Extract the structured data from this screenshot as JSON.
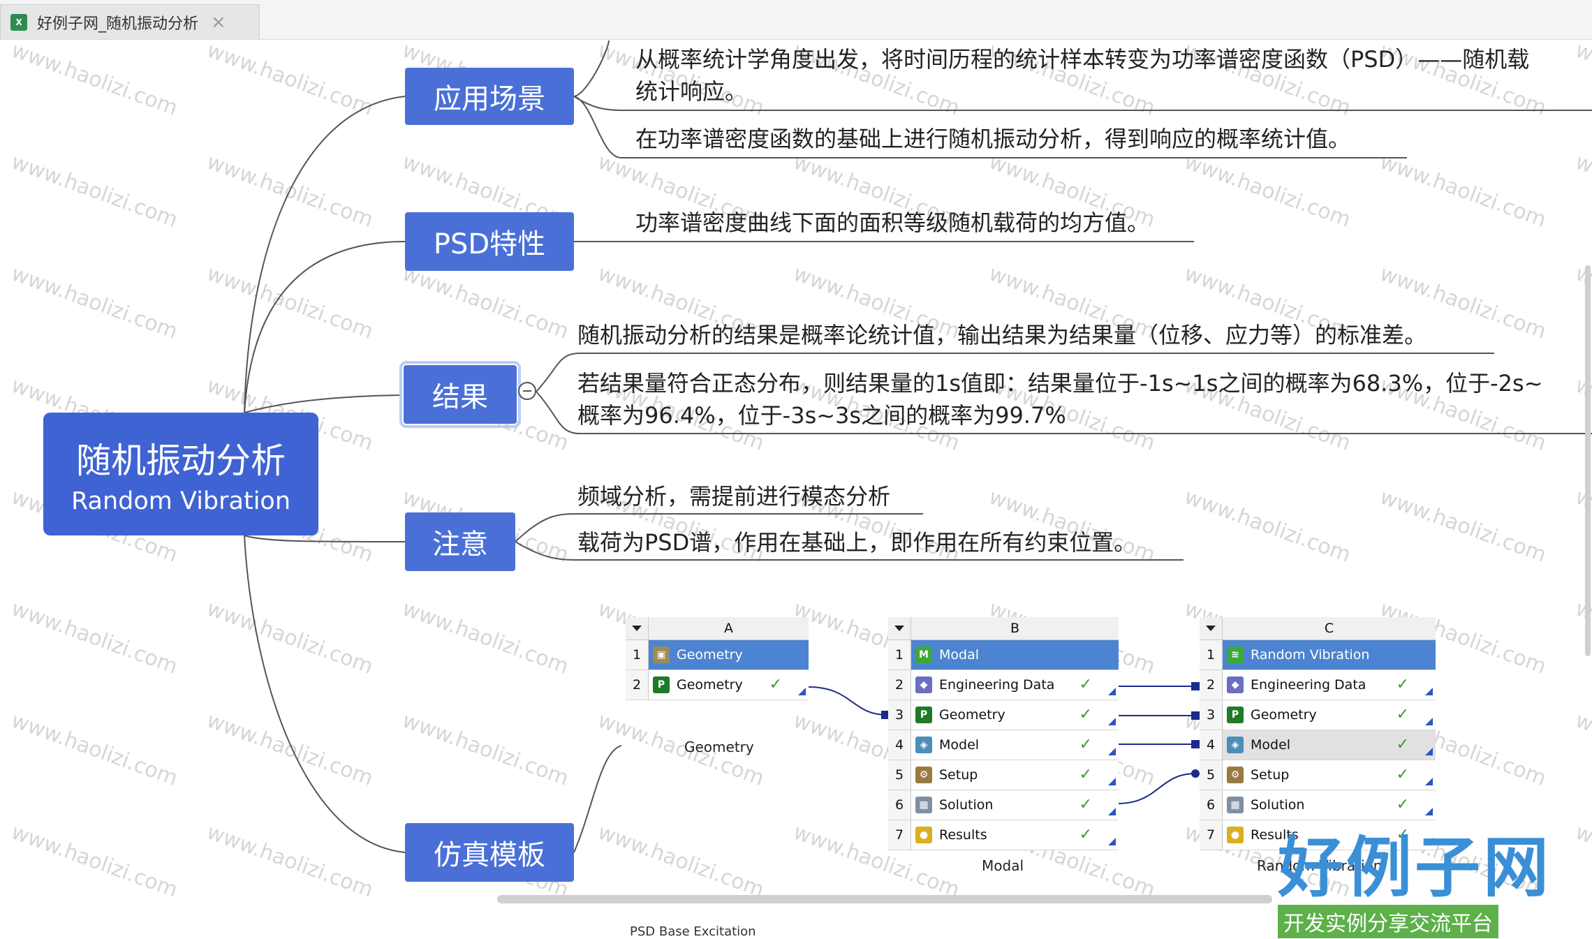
{
  "tab": {
    "icon": "xmind-file-icon",
    "title": "好例子网_随机振动分析",
    "close": "×"
  },
  "root": {
    "title_cn": "随机振动分析",
    "title_en": "Random Vibration"
  },
  "branches": [
    {
      "label": "应用场景",
      "leaves": [
        "从概率统计学角度出发，将时间历程的统计样本转变为功率谱密度函数（PSD）——随机载",
        "统计响应。",
        "在功率谱密度函数的基础上进行随机振动分析，得到响应的概率统计值。"
      ]
    },
    {
      "label": "PSD特性",
      "leaves": [
        "功率谱密度曲线下面的面积等级随机载荷的均方值。"
      ]
    },
    {
      "label": "结果",
      "leaves": [
        "随机振动分析的结果是概率论统计值，输出结果为结果量（位移、应力等）的标准差。",
        "若结果量符合正态分布，则结果量的1s值即：结果量位于-1s~1s之间的概率为68.3%，位于-2s~",
        "概率为96.4%，位于-3s~3s之间的概率为99.7%"
      ]
    },
    {
      "label": "注意",
      "leaves": [
        "频域分析，需提前进行模态分析",
        "载荷为PSD谱，作用在基础上，即作用在所有约束位置。"
      ]
    },
    {
      "label": "仿真模板",
      "leaves": []
    }
  ],
  "workbench": {
    "systems": [
      {
        "col": "A",
        "caption": "Geometry",
        "rows": [
          {
            "n": "1",
            "label": "Geometry",
            "icon": "geometry-box-icon",
            "title": true
          },
          {
            "n": "2",
            "label": "Geometry",
            "icon": "geometry-p-icon",
            "check": "✓"
          }
        ]
      },
      {
        "col": "B",
        "caption": "Modal",
        "rows": [
          {
            "n": "1",
            "label": "Modal",
            "icon": "modal-icon",
            "title": true
          },
          {
            "n": "2",
            "label": "Engineering Data",
            "icon": "engineering-data-icon",
            "check": "✓"
          },
          {
            "n": "3",
            "label": "Geometry",
            "icon": "geometry-p-icon",
            "check": "✓"
          },
          {
            "n": "4",
            "label": "Model",
            "icon": "model-icon",
            "check": "✓"
          },
          {
            "n": "5",
            "label": "Setup",
            "icon": "setup-icon",
            "check": "✓"
          },
          {
            "n": "6",
            "label": "Solution",
            "icon": "solution-icon",
            "check": "✓"
          },
          {
            "n": "7",
            "label": "Results",
            "icon": "results-icon",
            "check": "✓"
          }
        ]
      },
      {
        "col": "C",
        "caption": "Random Vibration",
        "rows": [
          {
            "n": "1",
            "label": "Random Vibration",
            "icon": "random-vibration-icon",
            "title": true
          },
          {
            "n": "2",
            "label": "Engineering Data",
            "icon": "engineering-data-icon",
            "check": "✓"
          },
          {
            "n": "3",
            "label": "Geometry",
            "icon": "geometry-p-icon",
            "check": "✓"
          },
          {
            "n": "4",
            "label": "Model",
            "icon": "model-icon",
            "check": "✓"
          },
          {
            "n": "5",
            "label": "Setup",
            "icon": "setup-icon",
            "check": "✓"
          },
          {
            "n": "6",
            "label": "Solution",
            "icon": "solution-icon",
            "check": "✓"
          },
          {
            "n": "7",
            "label": "Results",
            "icon": "results-icon",
            "check": "✓"
          }
        ]
      }
    ],
    "partial_label": "PSD Base Excitation"
  },
  "watermark": "www.haolizi.com",
  "logo": {
    "big": "好例子网",
    "small": "开发实例分享交流平台"
  },
  "colors": {
    "node": "#4a70d8",
    "root": "#3f63d2",
    "line": "#555555"
  }
}
